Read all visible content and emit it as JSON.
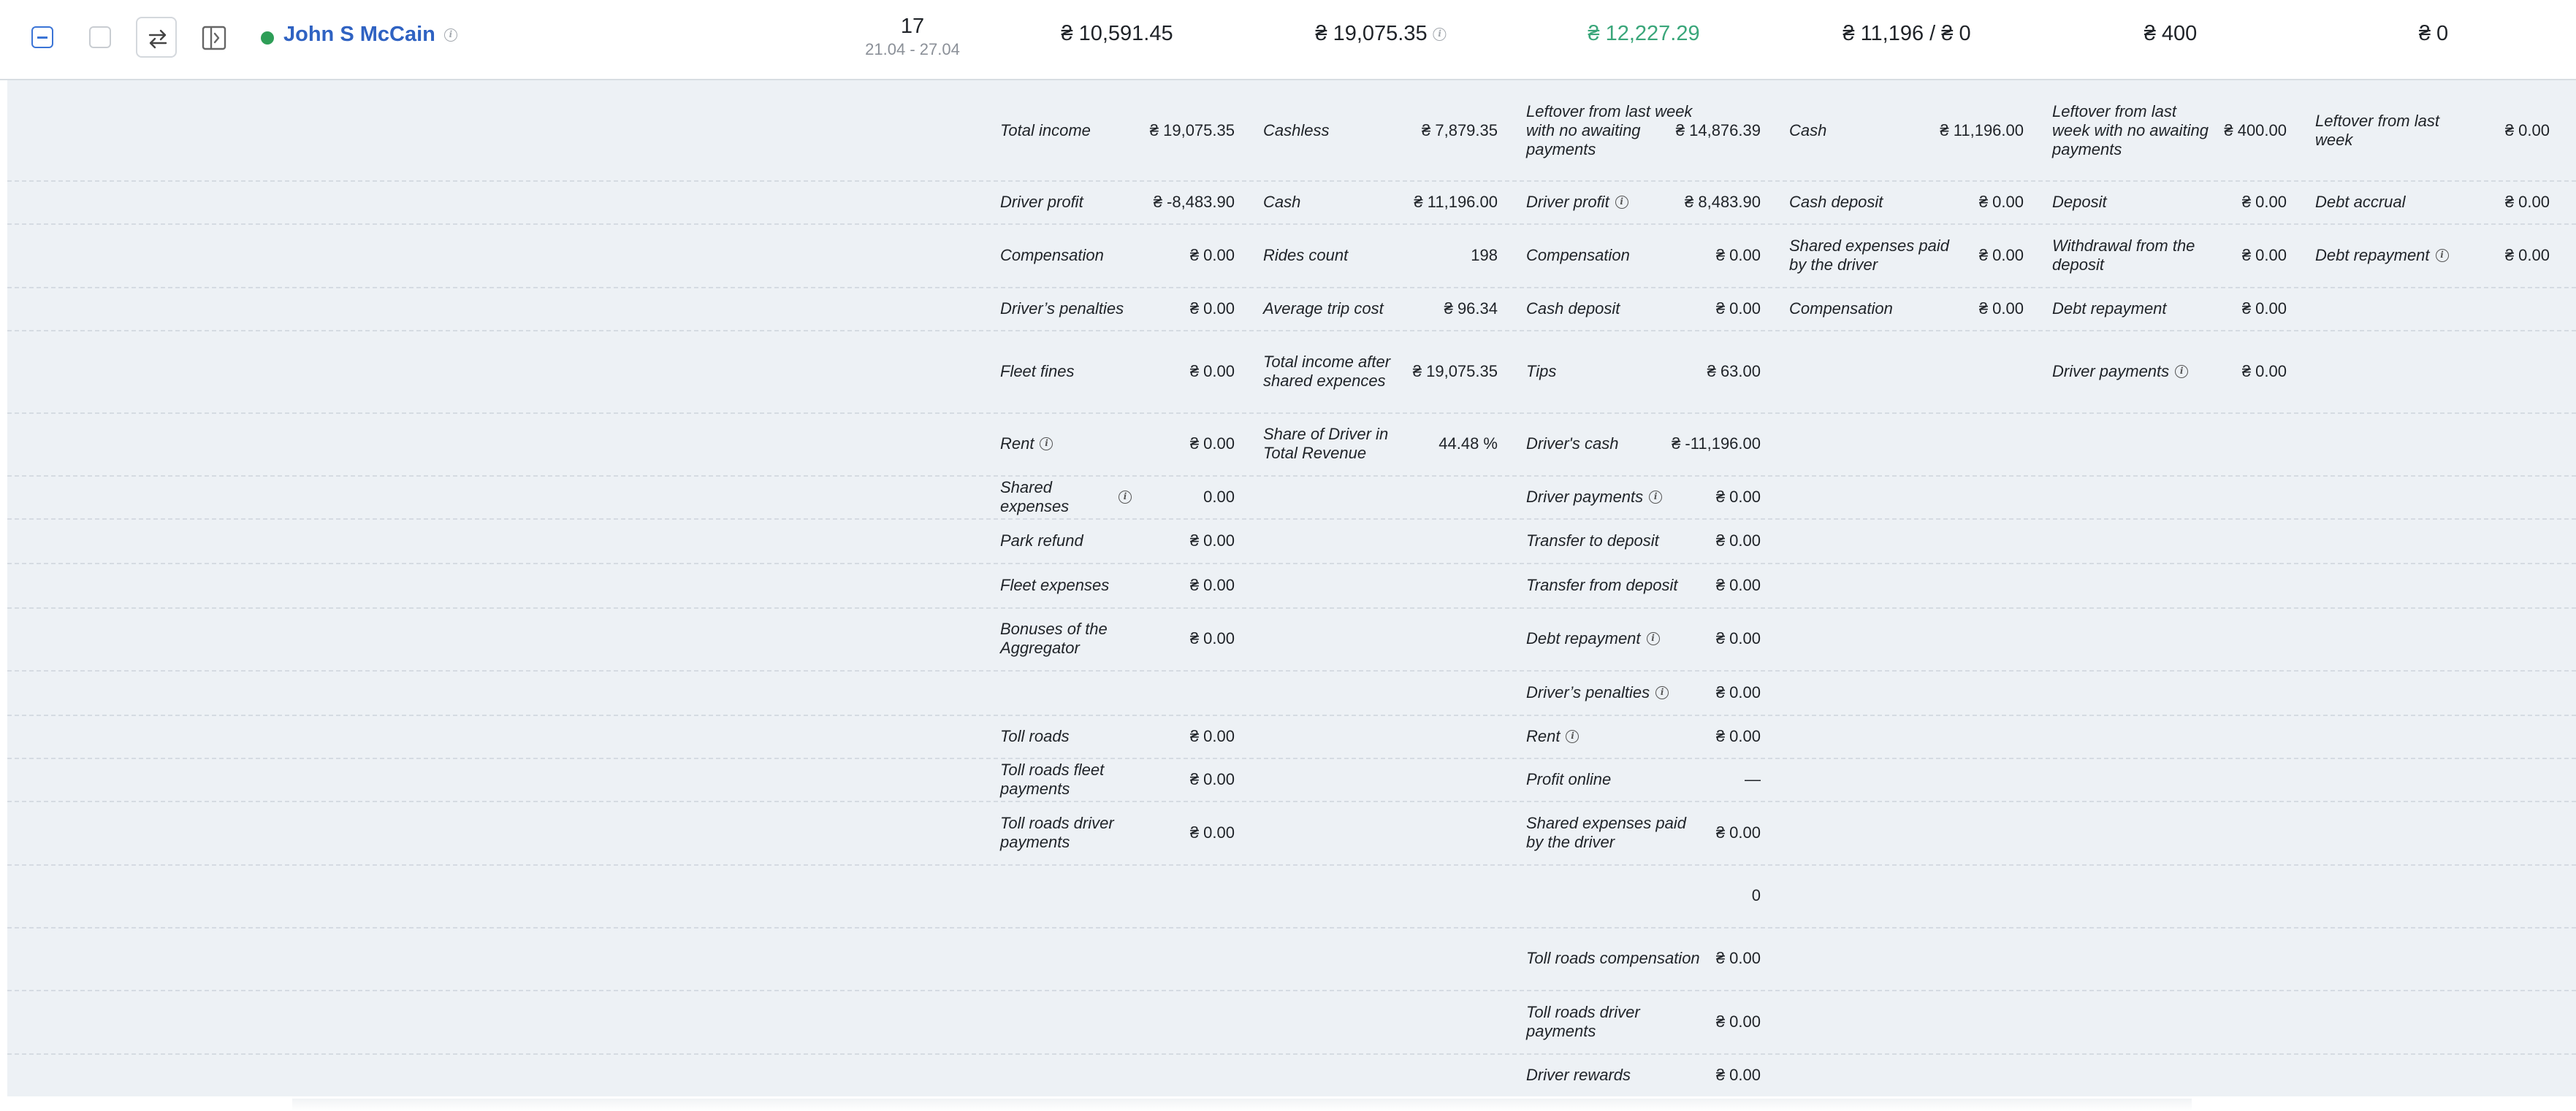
{
  "header": {
    "driver_name": "John S McCain",
    "week_number": "17",
    "week_range": "21.04 - 27.04",
    "summary": [
      {
        "key": "s1",
        "text": "₴ 10,591.45"
      },
      {
        "key": "s2",
        "text": "₴ 19,075.35"
      },
      {
        "key": "s3",
        "text": "₴ 12,227.29"
      },
      {
        "key": "s4",
        "text": "₴ 11,196  /  ₴ 0"
      },
      {
        "key": "s5",
        "text": "₴ 400"
      },
      {
        "key": "s6",
        "text": "₴ 0"
      }
    ],
    "colors": {
      "status_online": "#2e9e57",
      "name_link": "#2f62c2",
      "highlight_value": "#3aa67a"
    }
  },
  "details": {
    "col1": [
      {
        "label": "Total income",
        "value": "₴ 19,075.35"
      },
      {
        "label": "Driver profit",
        "value": "₴ -8,483.90"
      },
      {
        "label": "Compensation",
        "value": "₴ 0.00"
      },
      {
        "label": "Driver’s penalties",
        "value": "₴ 0.00"
      },
      {
        "label": "Fleet fines",
        "value": "₴ 0.00"
      },
      {
        "label": "Rent",
        "value": "₴ 0.00"
      },
      {
        "label": "Shared expenses",
        "value": "0.00"
      },
      {
        "label": "Park refund",
        "value": "₴ 0.00"
      },
      {
        "label": "Fleet expenses",
        "value": "₴ 0.00"
      },
      {
        "label": "Bonuses of the Aggregator",
        "value": "₴ 0.00"
      },
      {
        "label": "Toll roads",
        "value": "₴ 0.00"
      },
      {
        "label": "Toll roads fleet payments",
        "value": "₴ 0.00"
      },
      {
        "label": "Toll roads driver payments",
        "value": "₴ 0.00"
      }
    ],
    "col2": [
      {
        "label": "Cashless",
        "value": "₴ 7,879.35"
      },
      {
        "label": "Cash",
        "value": "₴ 11,196.00"
      },
      {
        "label": "Rides count",
        "value": "198"
      },
      {
        "label": "Average trip cost",
        "value": "₴ 96.34"
      },
      {
        "label": "Total income after shared expences",
        "value": "₴ 19,075.35"
      },
      {
        "label": "Share of Driver in Total Revenue",
        "value": "44.48 %"
      }
    ],
    "col3": [
      {
        "label": "Leftover from last week with no awaiting payments",
        "value": "₴ 14,876.39"
      },
      {
        "label": "Driver profit",
        "value": "₴ 8,483.90"
      },
      {
        "label": "Compensation",
        "value": "₴ 0.00"
      },
      {
        "label": "Cash deposit",
        "value": "₴ 0.00"
      },
      {
        "label": "Tips",
        "value": "₴ 63.00"
      },
      {
        "label": "Driver's cash",
        "value": "₴ -11,196.00"
      },
      {
        "label": "Driver payments",
        "value": "₴ 0.00"
      },
      {
        "label": "Transfer to deposit",
        "value": "₴ 0.00"
      },
      {
        "label": "Transfer from deposit",
        "value": "₴ 0.00"
      },
      {
        "label": "Debt repayment",
        "value": "₴ 0.00"
      },
      {
        "label": "Driver’s penalties",
        "value": "₴ 0.00"
      },
      {
        "label": "Rent",
        "value": "₴ 0.00"
      },
      {
        "label": "Profit online",
        "value": "—"
      },
      {
        "label": "Shared expenses paid by the driver",
        "value": "₴ 0.00"
      },
      {
        "label": "",
        "value": "0"
      },
      {
        "label": "Toll roads compensation",
        "value": "₴ 0.00"
      },
      {
        "label": "Toll roads driver payments",
        "value": "₴ 0.00"
      },
      {
        "label": "Driver rewards",
        "value": "₴ 0.00"
      }
    ],
    "col4": [
      {
        "label": "Cash",
        "value": "₴ 11,196.00"
      },
      {
        "label": "Cash deposit",
        "value": "₴ 0.00"
      },
      {
        "label": "Shared expenses paid by the driver",
        "value": "₴ 0.00"
      },
      {
        "label": "Compensation",
        "value": "₴ 0.00"
      }
    ],
    "col5": [
      {
        "label": "Leftover from last week with no awaiting payments",
        "value": "₴ 400.00"
      },
      {
        "label": "Deposit",
        "value": "₴ 0.00"
      },
      {
        "label": "Withdrawal from the deposit",
        "value": "₴ 0.00"
      },
      {
        "label": "Debt repayment",
        "value": "₴ 0.00"
      },
      {
        "label": "Driver payments",
        "value": "₴ 0.00"
      }
    ],
    "col6": [
      {
        "label": "Leftover from last week",
        "value": "₴ 0.00"
      },
      {
        "label": "Debt accrual",
        "value": "₴ 0.00"
      },
      {
        "label": "Debt repayment",
        "value": "₴ 0.00"
      }
    ]
  }
}
